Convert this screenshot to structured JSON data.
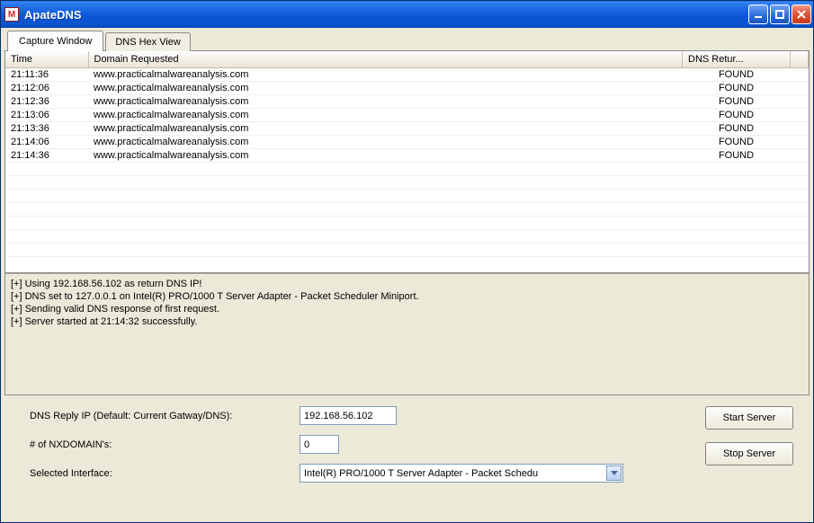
{
  "window": {
    "title": "ApateDNS"
  },
  "tabs": [
    {
      "label": "Capture Window",
      "active": true
    },
    {
      "label": "DNS Hex View",
      "active": false
    }
  ],
  "table": {
    "columns": {
      "time": "Time",
      "domain": "Domain Requested",
      "return": "DNS Retur..."
    },
    "rows": [
      {
        "time": "21:11:36",
        "domain": "www.practicalmalwareanalysis.com",
        "return": "FOUND"
      },
      {
        "time": "21:12:06",
        "domain": "www.practicalmalwareanalysis.com",
        "return": "FOUND"
      },
      {
        "time": "21:12:36",
        "domain": "www.practicalmalwareanalysis.com",
        "return": "FOUND"
      },
      {
        "time": "21:13:06",
        "domain": "www.practicalmalwareanalysis.com",
        "return": "FOUND"
      },
      {
        "time": "21:13:36",
        "domain": "www.practicalmalwareanalysis.com",
        "return": "FOUND"
      },
      {
        "time": "21:14:06",
        "domain": "www.practicalmalwareanalysis.com",
        "return": "FOUND"
      },
      {
        "time": "21:14:36",
        "domain": "www.practicalmalwareanalysis.com",
        "return": "FOUND"
      }
    ]
  },
  "log": [
    "[+] Using 192.168.56.102 as return DNS IP!",
    "[+] DNS set to 127.0.0.1 on Intel(R) PRO/1000 T Server Adapter - Packet Scheduler Miniport.",
    "[+] Sending valid DNS response of first request.",
    "[+] Server started at 21:14:32 successfully."
  ],
  "form": {
    "reply_ip_label": "DNS Reply IP (Default: Current Gatway/DNS):",
    "reply_ip_value": "192.168.56.102",
    "nx_label": "# of NXDOMAIN's:",
    "nx_value": "0",
    "iface_label": "Selected Interface:",
    "iface_value": "Intel(R) PRO/1000 T Server Adapter - Packet Schedu"
  },
  "buttons": {
    "start": "Start Server",
    "stop": "Stop Server"
  }
}
